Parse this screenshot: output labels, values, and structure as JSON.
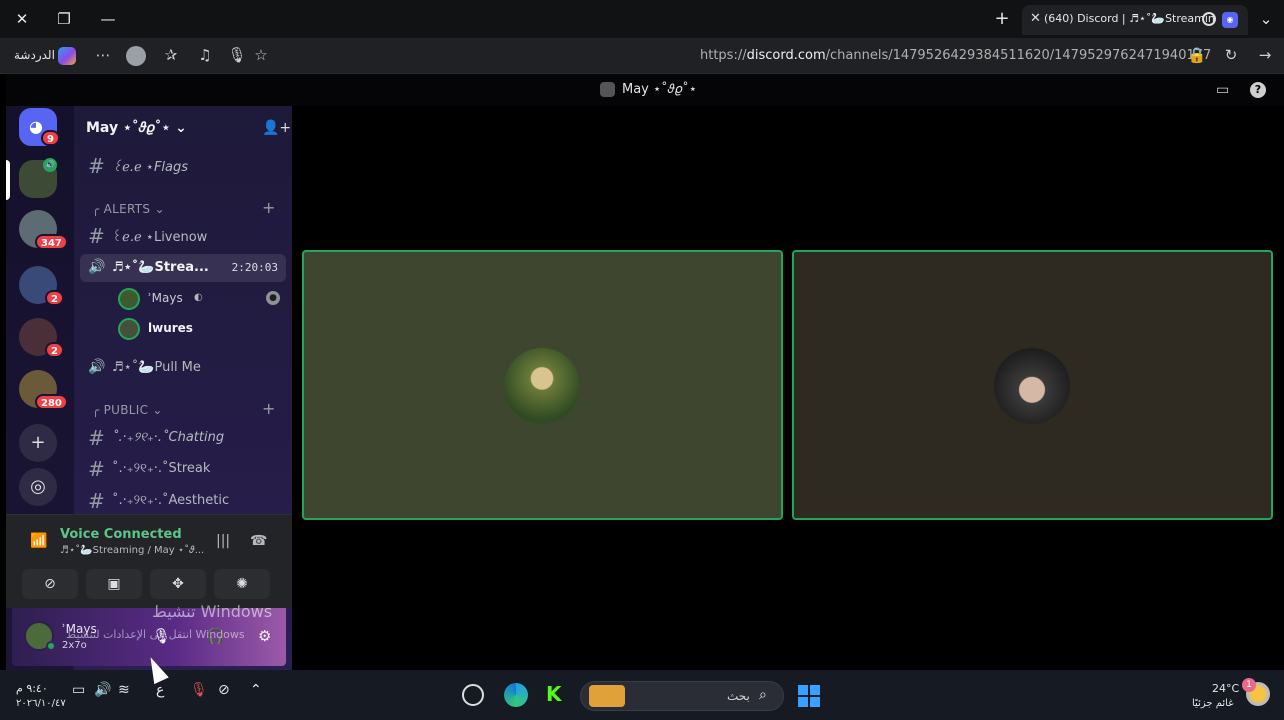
{
  "browser": {
    "tab_title": "(640) Discord | ♬⋆˚🦢Streaming",
    "tab_badge": "640",
    "url_prefix": "https://",
    "url_domain": "discord.com",
    "url_path": "/channels/1479526429384511620/1479529762471940177",
    "chat_label": "الدردشة",
    "icons": [
      "close-icon",
      "restore-icon",
      "minimize-icon",
      "new-tab-icon",
      "tab-close-icon",
      "record-icon",
      "tab-list-icon",
      "copilot-icon",
      "more-icon",
      "avatar-icon",
      "favorites-icon",
      "read-aloud-icon",
      "mic-icon",
      "star-icon",
      "lock-icon",
      "reload-icon",
      "forward-icon"
    ]
  },
  "app": {
    "window_title": "May ⋆˚𝜗𝜚˚⋆",
    "inbox_icon": "inbox-icon",
    "help_icon": "help-icon"
  },
  "servers": {
    "dm_badge": "9",
    "badges": [
      "347",
      "2",
      "2",
      "280"
    ],
    "add_icon": "add-server-icon",
    "discover_icon": "compass-icon"
  },
  "sidebar": {
    "server_name": "May ⋆˚𝜗𝜚˚⋆",
    "channels": {
      "flags": "꒰ℯ.ℯ ⋆Flags",
      "alerts_category": "╭ ALERTS",
      "livenow": "꒰ℯ.ℯ ⋆Livenow",
      "streaming": "♬⋆˚🦢Strea...",
      "streaming_timer": "2:20:03",
      "pull_me": "♬⋆˚🦢Pull Me",
      "public_category": "╭ PUBLIC",
      "chatting": "˚.‧₊୨୧₊‧.˚Chatting",
      "streak": "˚.‧₊୨୧₊‧.˚Streak",
      "aesthetic": "˚.‧₊୨୧₊‧.˚Aesthetic"
    },
    "voice_users": [
      {
        "name": "ʾMays",
        "bold": false
      },
      {
        "name": "lwures",
        "bold": true
      }
    ]
  },
  "voice_panel": {
    "title": "Voice Connected",
    "subtitle": "♬⋆˚🦢Streaming / May ⋆˚𝜗..."
  },
  "user_panel": {
    "name": "ʾMays",
    "tag": "2x7o",
    "watermark_line1": "تنشيط Windows",
    "watermark_line2": "انتقل إلى الإعدادات لتنشيط Windows"
  },
  "taskbar": {
    "time": "٩:٤٠ م",
    "date": "٢٠٢٦/١٠/٤٧",
    "lang": "ع",
    "search_label": "بحث",
    "weather_temp": "24°C",
    "weather_cond": "غائم جزئيًا",
    "weather_badge": "1"
  },
  "colors": {
    "speaking_green": "#23a55a",
    "sidebar_purple": "#231c44",
    "badge_red": "#f23f43",
    "tile_left": "#3f4630",
    "tile_right": "#2e2a22"
  }
}
